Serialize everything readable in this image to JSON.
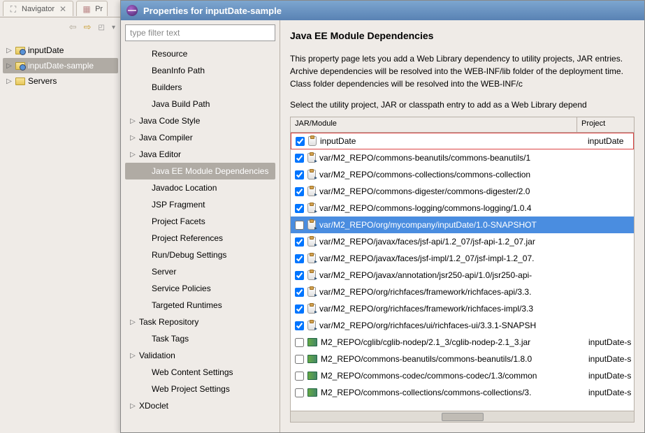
{
  "navigator": {
    "tab1_label": "Navigator",
    "tab2_label": "Pr",
    "items": [
      {
        "label": "inputDate",
        "expand": "▷",
        "icon": "proj"
      },
      {
        "label": "inputDate-sample",
        "expand": "▷",
        "icon": "proj",
        "selected": true
      },
      {
        "label": "Servers",
        "expand": "▷",
        "icon": "folder"
      }
    ]
  },
  "dialog": {
    "title": "Properties for inputDate-sample",
    "filter_placeholder": "type filter text",
    "sections": [
      {
        "label": "Resource",
        "indent": true
      },
      {
        "label": "BeanInfo Path",
        "indent": true
      },
      {
        "label": "Builders",
        "indent": true
      },
      {
        "label": "Java Build Path",
        "indent": true
      },
      {
        "label": "Java Code Style",
        "expand": "▷"
      },
      {
        "label": "Java Compiler",
        "expand": "▷"
      },
      {
        "label": "Java Editor",
        "expand": "▷"
      },
      {
        "label": "Java EE Module Dependencies",
        "indent": true,
        "selected": true
      },
      {
        "label": "Javadoc Location",
        "indent": true
      },
      {
        "label": "JSP Fragment",
        "indent": true
      },
      {
        "label": "Project Facets",
        "indent": true
      },
      {
        "label": "Project References",
        "indent": true
      },
      {
        "label": "Run/Debug Settings",
        "indent": true
      },
      {
        "label": "Server",
        "indent": true
      },
      {
        "label": "Service Policies",
        "indent": true
      },
      {
        "label": "Targeted Runtimes",
        "indent": true
      },
      {
        "label": "Task Repository",
        "expand": "▷"
      },
      {
        "label": "Task Tags",
        "indent": true
      },
      {
        "label": "Validation",
        "expand": "▷"
      },
      {
        "label": "Web Content Settings",
        "indent": true
      },
      {
        "label": "Web Project Settings",
        "indent": true
      },
      {
        "label": "XDoclet",
        "expand": "▷"
      }
    ],
    "content": {
      "heading": "Java EE Module Dependencies",
      "description": "This property page lets you add a Web Library dependency to utility projects, JAR entries. Archive dependencies will be resolved into the WEB-INF/lib folder of the deployment time. Class folder dependencies will be resolved into the WEB-INF/c",
      "instruction": "Select the utility project, JAR or classpath entry to add as a Web Library depend",
      "col_jar": "JAR/Module",
      "col_project": "Project",
      "rows": [
        {
          "checked": true,
          "icon": "jar",
          "label": "inputDate",
          "project": "inputDate",
          "highlighted": true
        },
        {
          "checked": true,
          "icon": "jarv",
          "label": "var/M2_REPO/commons-beanutils/commons-beanutils/1"
        },
        {
          "checked": true,
          "icon": "jarv",
          "label": "var/M2_REPO/commons-collections/commons-collection"
        },
        {
          "checked": true,
          "icon": "jarv",
          "label": "var/M2_REPO/commons-digester/commons-digester/2.0"
        },
        {
          "checked": true,
          "icon": "jarv",
          "label": "var/M2_REPO/commons-logging/commons-logging/1.0.4"
        },
        {
          "checked": false,
          "icon": "jarv",
          "label": "var/M2_REPO/org/mycompany/inputDate/1.0-SNAPSHOT",
          "selected": true
        },
        {
          "checked": true,
          "icon": "jarv",
          "label": "var/M2_REPO/javax/faces/jsf-api/1.2_07/jsf-api-1.2_07.jar"
        },
        {
          "checked": true,
          "icon": "jarv",
          "label": "var/M2_REPO/javax/faces/jsf-impl/1.2_07/jsf-impl-1.2_07."
        },
        {
          "checked": true,
          "icon": "jarv",
          "label": "var/M2_REPO/javax/annotation/jsr250-api/1.0/jsr250-api-"
        },
        {
          "checked": true,
          "icon": "jarv",
          "label": "var/M2_REPO/org/richfaces/framework/richfaces-api/3.3."
        },
        {
          "checked": true,
          "icon": "jarv",
          "label": "var/M2_REPO/org/richfaces/framework/richfaces-impl/3.3"
        },
        {
          "checked": true,
          "icon": "jarv",
          "label": "var/M2_REPO/org/richfaces/ui/richfaces-ui/3.3.1-SNAPSH"
        },
        {
          "checked": false,
          "icon": "lib",
          "label": "M2_REPO/cglib/cglib-nodep/2.1_3/cglib-nodep-2.1_3.jar",
          "project": "inputDate-s"
        },
        {
          "checked": false,
          "icon": "lib",
          "label": "M2_REPO/commons-beanutils/commons-beanutils/1.8.0",
          "project": "inputDate-s"
        },
        {
          "checked": false,
          "icon": "lib",
          "label": "M2_REPO/commons-codec/commons-codec/1.3/common",
          "project": "inputDate-s"
        },
        {
          "checked": false,
          "icon": "lib",
          "label": "M2_REPO/commons-collections/commons-collections/3.",
          "project": "inputDate-s"
        }
      ]
    }
  }
}
